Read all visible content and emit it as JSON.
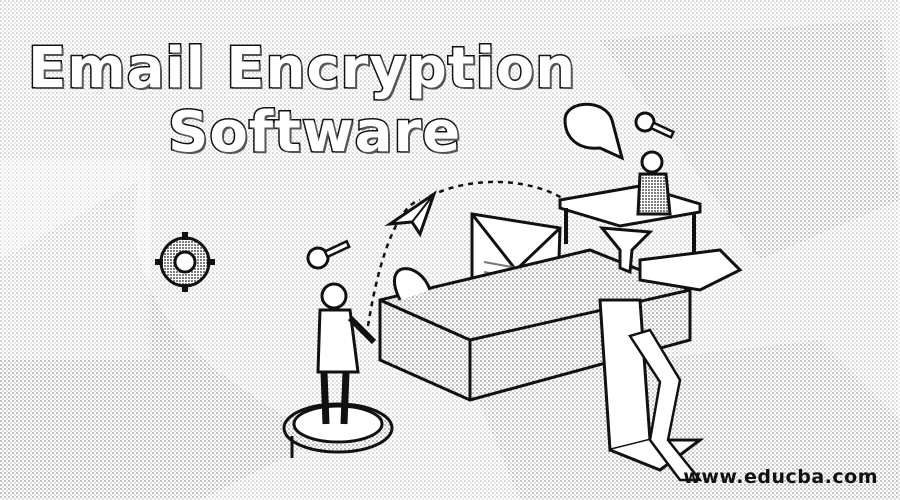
{
  "image": {
    "title_line_1": "Email Encryption",
    "title_line_2": "Software",
    "watermark": "www.educba.com"
  },
  "colors": {
    "ink": "#111111",
    "paper": "#ffffff",
    "halftone": "#8a8a8a"
  },
  "illustration": {
    "icons": [
      "key-icon",
      "speech-bubble-icon",
      "paper-plane-icon",
      "gear-icon",
      "envelope-icon",
      "funnel-icon"
    ]
  }
}
